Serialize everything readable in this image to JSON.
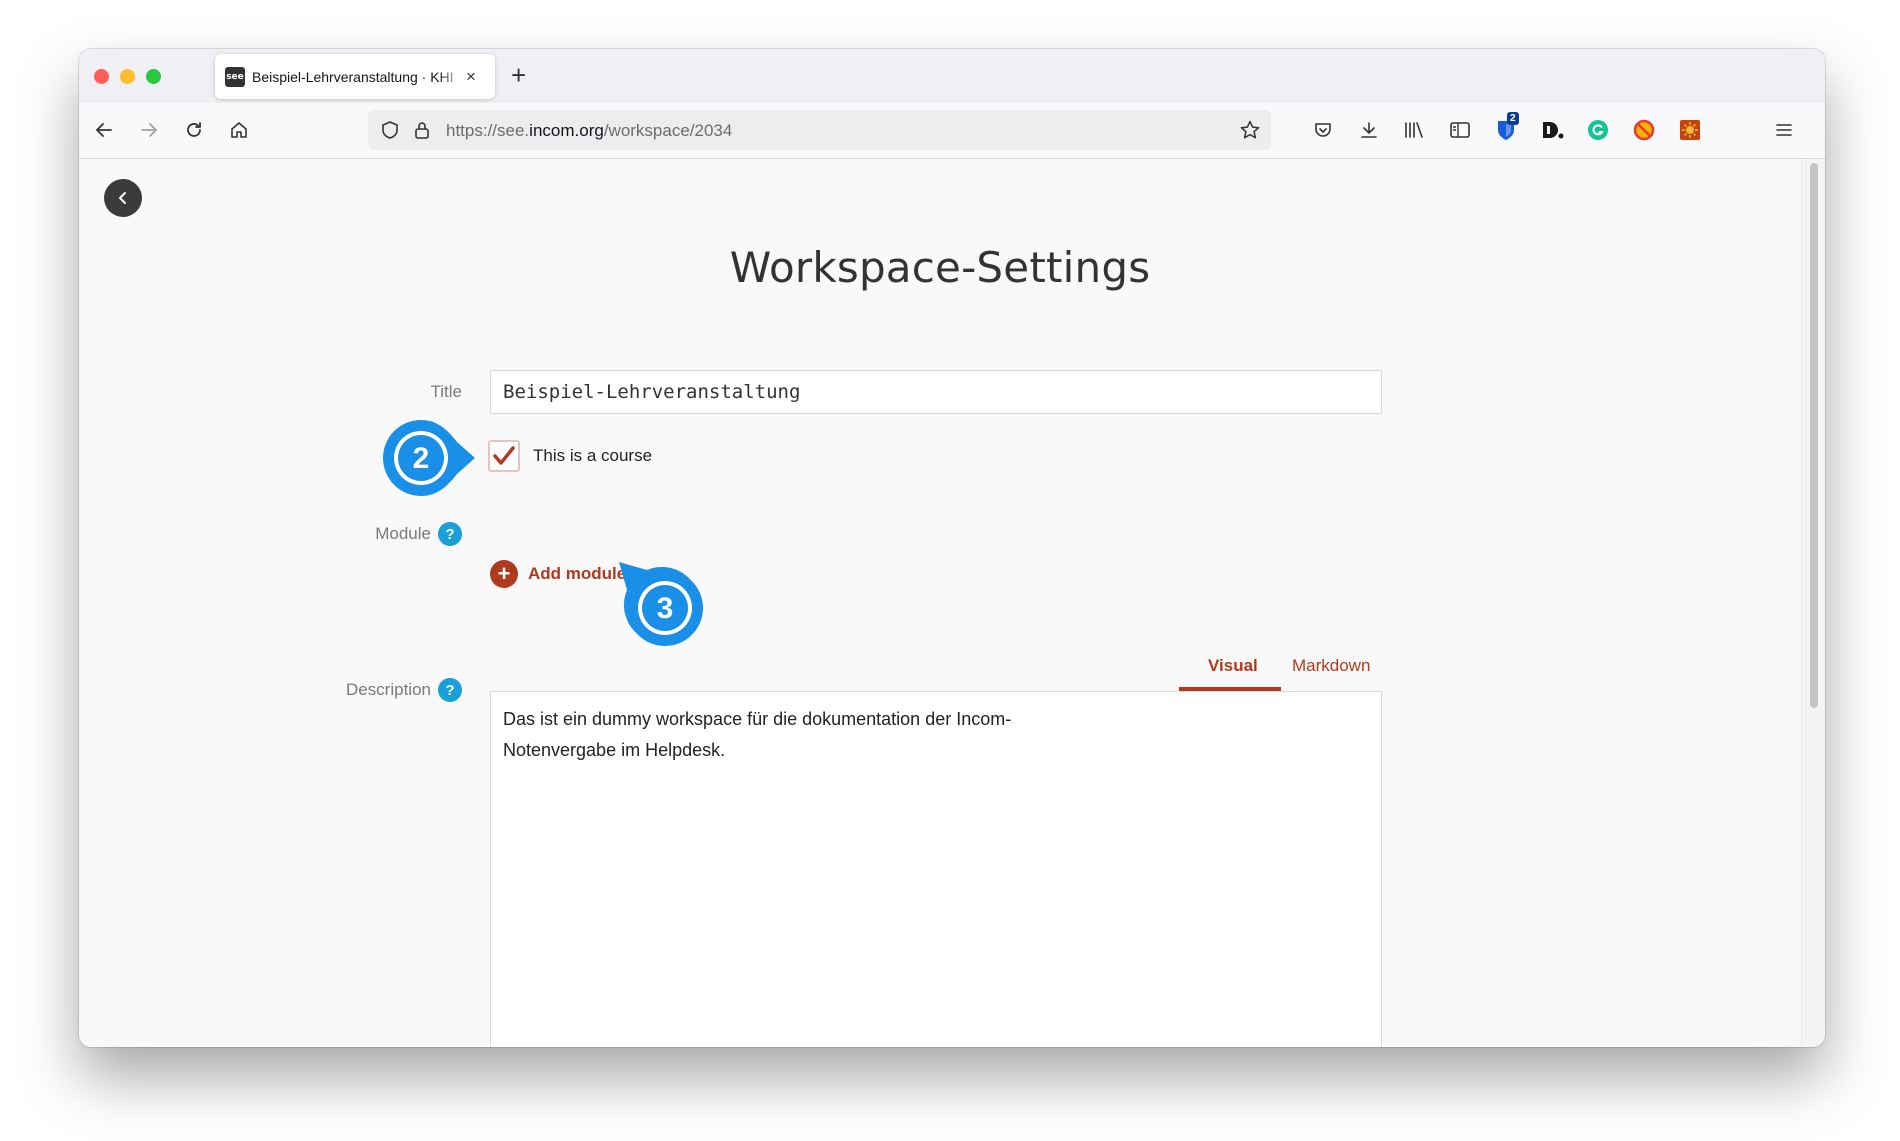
{
  "browser": {
    "tab_title": "Beispiel-Lehrveranstaltung · KHI",
    "tab_favicon_text": "see",
    "tab_close": "×",
    "new_tab": "+",
    "url_prefix": "https://see.",
    "url_domain": "incom.org",
    "url_path": "/workspace/2034",
    "extension_badge": "2"
  },
  "page": {
    "title": "Workspace-Settings",
    "form": {
      "title_label": "Title",
      "title_value": "Beispiel-Lehrveranstaltung",
      "course_checkbox_label": "This is a course",
      "course_checked": true,
      "module_label": "Module",
      "add_module_label": "Add module",
      "description_label": "Description",
      "help_glyph": "?",
      "plus_glyph": "+",
      "editor_tabs": [
        "Visual",
        "Markdown"
      ],
      "active_editor_tab": "Visual",
      "description_value": "Das ist ein dummy workspace für die dokumentation der Incom-Notenvergabe im Helpdesk."
    }
  },
  "annotations": {
    "callout_2": "2",
    "callout_3": "3",
    "color": "#1a8fe8"
  },
  "colors": {
    "accent": "#b03a1e",
    "help": "#1aa0d8"
  }
}
